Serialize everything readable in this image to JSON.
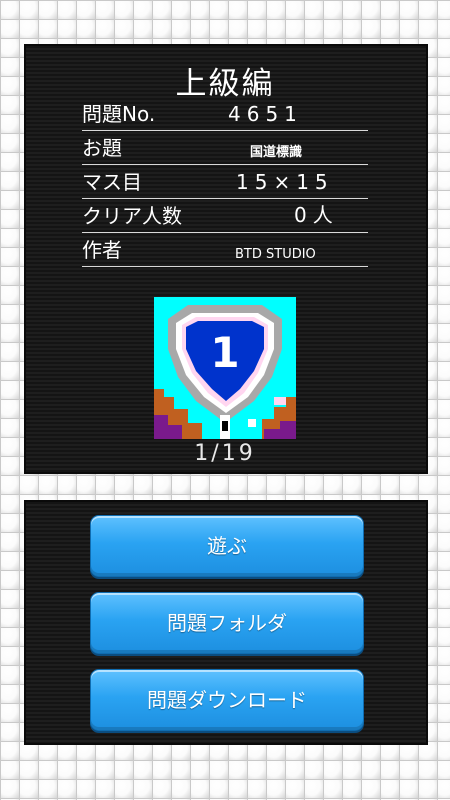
{
  "header": {
    "title": "上級編"
  },
  "info": [
    {
      "label": "問題No.",
      "value": "4651"
    },
    {
      "label": "お題",
      "value": "国道標識"
    },
    {
      "label": "マス目",
      "value": "15×15"
    },
    {
      "label": "クリア人数",
      "value": "0人"
    },
    {
      "label": "作者",
      "value": "BTD STUDIO"
    }
  ],
  "puzzle": {
    "progress_text": "1/19",
    "sign_number": "1",
    "colors": {
      "background": "#00ffff",
      "shield": "#0033cc",
      "outline": "#a8a8a8",
      "trim": "#ffd6f0",
      "ground": "#7a1a8c",
      "earth": "#c06020"
    }
  },
  "menu": {
    "play_label": "遊ぶ",
    "folder_label": "問題フォルダ",
    "download_label": "問題ダウンロード"
  },
  "colors": {
    "button": "#2aa3f2",
    "panel": "#1a1a1a"
  }
}
